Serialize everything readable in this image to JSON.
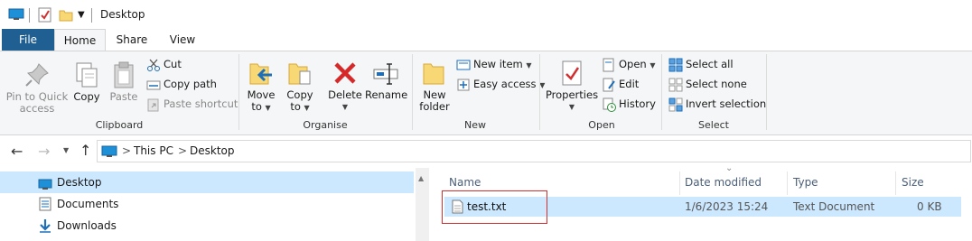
{
  "titlebar": {
    "title": "Desktop"
  },
  "tabs": {
    "file": "File",
    "home": "Home",
    "share": "Share",
    "view": "View"
  },
  "ribbon": {
    "clipboard": {
      "label": "Clipboard",
      "pin_line1": "Pin to Quick",
      "pin_line2": "access",
      "copy": "Copy",
      "paste": "Paste",
      "cut": "Cut",
      "copy_path": "Copy path",
      "paste_shortcut": "Paste shortcut"
    },
    "organise": {
      "label": "Organise",
      "move_to": "Move",
      "move_to_2": "to",
      "copy_to": "Copy",
      "copy_to_2": "to",
      "delete": "Delete",
      "rename": "Rename"
    },
    "new": {
      "label": "New",
      "new_folder_1": "New",
      "new_folder_2": "folder",
      "new_item": "New item",
      "easy_access": "Easy access"
    },
    "open": {
      "label": "Open",
      "properties": "Properties",
      "open": "Open",
      "edit": "Edit",
      "history": "History"
    },
    "select": {
      "label": "Select",
      "select_all": "Select all",
      "select_none": "Select none",
      "invert_selection": "Invert selection"
    }
  },
  "address": {
    "crumbs": [
      "This PC",
      "Desktop"
    ],
    "separator": ">"
  },
  "nav": {
    "items": [
      "Desktop",
      "Documents",
      "Downloads"
    ]
  },
  "filelist": {
    "columns": [
      "Name",
      "Date modified",
      "Type",
      "Size"
    ],
    "rows": [
      {
        "name": "test.txt",
        "date": "1/6/2023 15:24",
        "type": "Text Document",
        "size": "0 KB"
      }
    ]
  },
  "colors": {
    "file_tab": "#1f5f91",
    "selection": "#cce8ff",
    "highlight_box": "#d03030",
    "accent_blue": "#0078d7"
  }
}
